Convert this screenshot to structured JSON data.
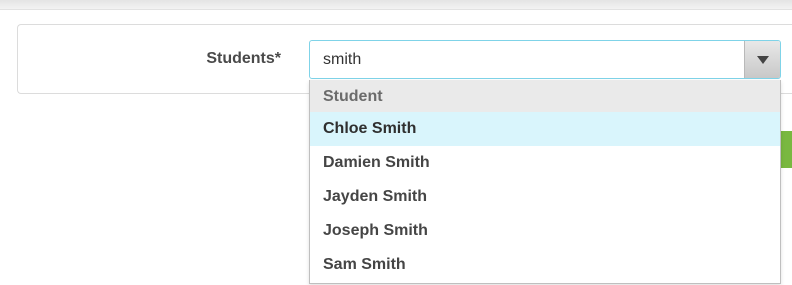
{
  "form": {
    "students_label": "Students*",
    "search_value": "smith",
    "toggle_icon": "chevron-down-icon"
  },
  "dropdown": {
    "group_header": "Student",
    "items": [
      {
        "label": "Chloe Smith",
        "highlighted": true
      },
      {
        "label": "Damien Smith",
        "highlighted": false
      },
      {
        "label": "Jayden Smith",
        "highlighted": false
      },
      {
        "label": "Joseph Smith",
        "highlighted": false
      },
      {
        "label": "Sam Smith",
        "highlighted": false
      }
    ]
  },
  "colors": {
    "highlight": "#d9f5fc",
    "input_border": "#7fd3e8",
    "accent_green": "#79b840"
  }
}
